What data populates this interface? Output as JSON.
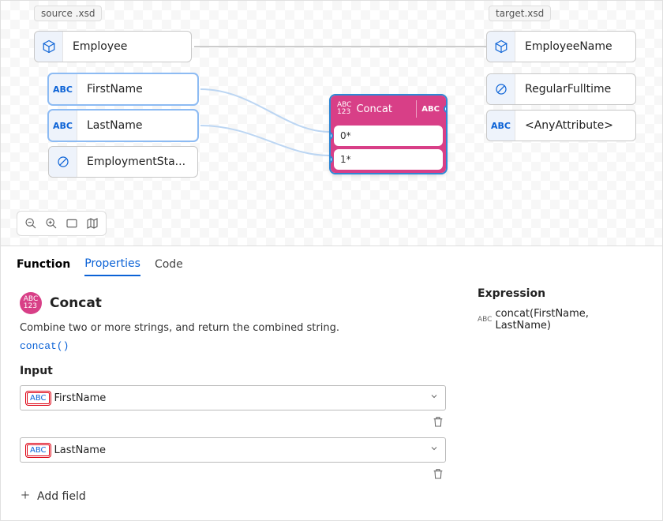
{
  "source_tag": "source .xsd",
  "target_tag": "target.xsd",
  "source_root": "Employee",
  "source_fields": {
    "firstname": "FirstName",
    "lastname": "LastName",
    "employment": "EmploymentSta..."
  },
  "target_root": "EmployeeName",
  "target_fields": {
    "fulltime": "RegularFulltime",
    "anyattr": "<AnyAttribute>"
  },
  "concat": {
    "label": "Concat",
    "slot0": "0*",
    "slot1": "1*"
  },
  "tabs": {
    "function": "Function",
    "properties": "Properties",
    "code": "Code"
  },
  "fn": {
    "name": "Concat",
    "desc": "Combine two or more strings, and return the combined string.",
    "sig": "concat()"
  },
  "input_label": "Input",
  "inputs": {
    "first": "FirstName",
    "last": "LastName"
  },
  "add_field": "Add field",
  "expression_label": "Expression",
  "expression_value": "concat(FirstName, LastName)"
}
